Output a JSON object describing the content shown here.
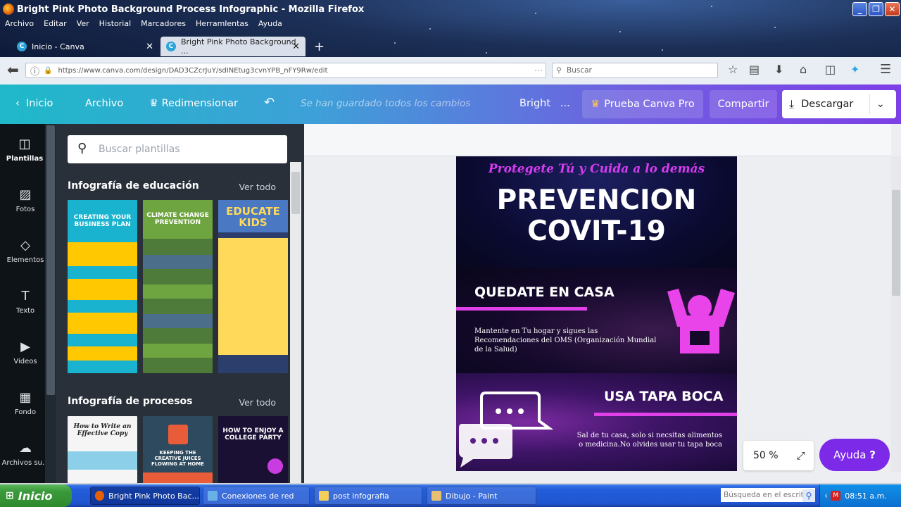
{
  "window": {
    "title": "Bright Pink Photo Background Process Infographic - Mozilla Firefox"
  },
  "menu": [
    "Archivo",
    "Editar",
    "Ver",
    "Historial",
    "Marcadores",
    "Herramientas",
    "Ayuda"
  ],
  "tabs": [
    {
      "label": "Inicio - Canva",
      "active": false
    },
    {
      "label": "Bright Pink Photo Background ...",
      "active": true
    }
  ],
  "nav": {
    "url": "https://www.canva.com/design/DAD3CZcrJuY/sdINEtug3cvnYPB_nFY9Rw/edit",
    "search_placeholder": "Buscar"
  },
  "canva_top": {
    "home": "Inicio",
    "file": "Archivo",
    "resize": "Redimensionar",
    "saved": "Se han guardado todos los cambios",
    "design_name": "Bright",
    "ellipsis": "...",
    "pro": "Prueba Canva Pro",
    "share": "Compartir",
    "download": "Descargar"
  },
  "rail": [
    {
      "label": "Plantillas",
      "icon": "templates-icon",
      "active": true
    },
    {
      "label": "Fotos",
      "icon": "photos-icon"
    },
    {
      "label": "Elementos",
      "icon": "elements-icon"
    },
    {
      "label": "Texto",
      "icon": "text-icon"
    },
    {
      "label": "Videos",
      "icon": "videos-icon"
    },
    {
      "label": "Fondo",
      "icon": "background-icon"
    },
    {
      "label": "Archivos su...",
      "icon": "uploads-icon"
    }
  ],
  "panel": {
    "search_placeholder": "Buscar plantillas",
    "sections": [
      {
        "title": "Infografía de educación",
        "see_all": "Ver todo",
        "templates": [
          {
            "title": "CREATING YOUR BUSINESS PLAN",
            "bg": "#1ab3cf"
          },
          {
            "title": "CLIMATE CHANGE PREVENTION",
            "bg": "#5a8c3a"
          },
          {
            "title": "EDUCATE KIDS",
            "bg": "#4a78c2"
          }
        ]
      },
      {
        "title": "Infografía de procesos",
        "see_all": "Ver todo",
        "templates": [
          {
            "title": "How to Write an Effective Copy",
            "bg": "#f5f5f5"
          },
          {
            "title": "KEEPING THE CREATIVE JUICES FLOWING AT HOME",
            "bg": "#2e4a5e"
          },
          {
            "title": "HOW TO ENJOY A COLLEGE PARTY",
            "bg": "#1a1033"
          }
        ]
      }
    ]
  },
  "infographic": {
    "tagline": "Protegete Tú y Cuida a lo demás",
    "title_line1": "PREVENCION",
    "title_line2": "COVIT-19",
    "s2_heading": "QUEDATE EN CASA",
    "s2_body": "Mantente en Tu hogar y sigues las Recomendaciones del OMS (Organización Mundial de la Salud)",
    "s3_heading": "USA TAPA BOCA",
    "s3_body": "Sal de tu casa, solo si necsitas alimentos o medicina.No olvides usar tu tapa boca"
  },
  "zoom": "50 %",
  "help": "Ayuda",
  "help_glyph": "?",
  "taskbar": {
    "start": "Inicio",
    "items": [
      {
        "label": "Bright Pink Photo Bac...",
        "active": true
      },
      {
        "label": "Conexiones de red",
        "active": false
      },
      {
        "label": "post infografia",
        "active": false
      },
      {
        "label": "Dibujo - Paint",
        "active": false
      }
    ],
    "search_placeholder": "Búsqueda en el escrit",
    "clock": "08:51 a.m."
  },
  "colors": {
    "accent": "#7d2ae8",
    "pink": "#e040e8",
    "tagline": "#d63cf0"
  }
}
